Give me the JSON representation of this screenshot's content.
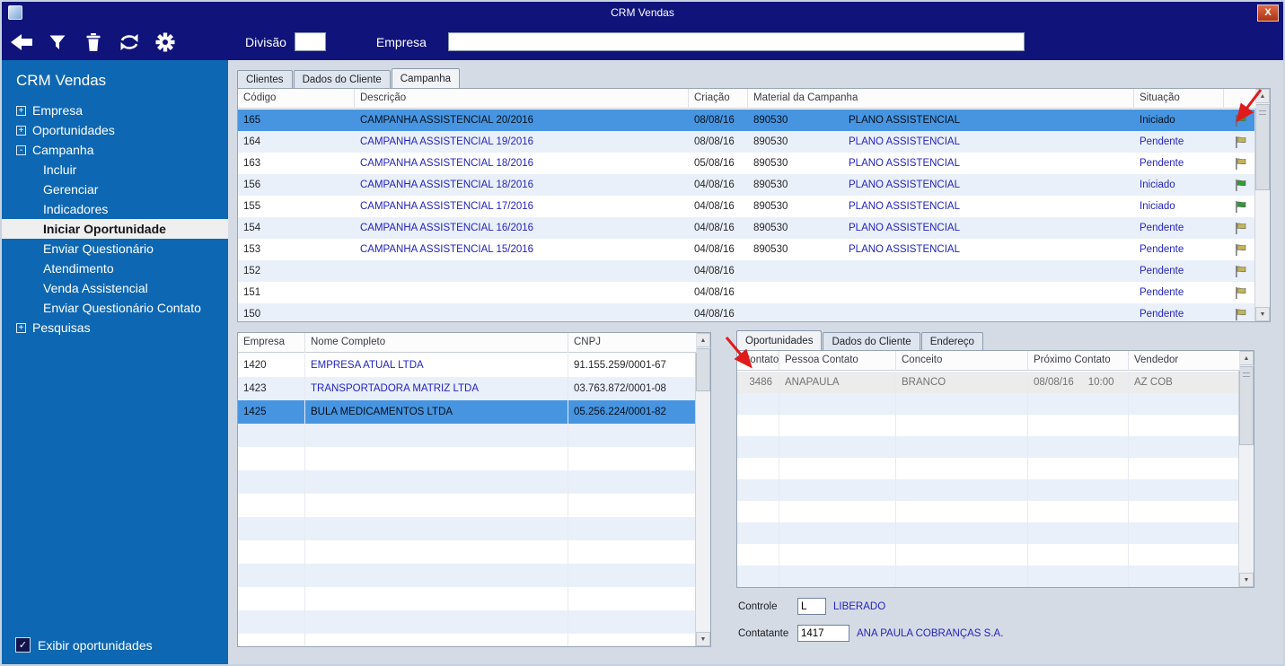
{
  "colors": {
    "accent_navy": "#10137a",
    "sidebar_blue": "#0e67b2",
    "selection_blue": "#4795e0",
    "data_blue": "#2424bc",
    "flag_green": "#2f9b38",
    "flag_yellow": "#c4b35a",
    "annotation_red": "#e01b1b"
  },
  "window": {
    "title": "CRM Vendas",
    "close_glyph": "X"
  },
  "toolbar": {
    "icons": [
      "back-icon",
      "filter-icon",
      "delete-icon",
      "refresh-icon",
      "settings-icon"
    ],
    "divisao_label": "Divisão",
    "divisao_value": "",
    "empresa_label": "Empresa",
    "empresa_value": ""
  },
  "sidebar": {
    "title": "CRM Vendas",
    "items": [
      {
        "label": "Empresa",
        "expand": "+",
        "level": 0
      },
      {
        "label": "Oportunidades",
        "expand": "+",
        "level": 0
      },
      {
        "label": "Campanha",
        "expand": "-",
        "level": 0
      },
      {
        "label": "Incluir",
        "level": 1
      },
      {
        "label": "Gerenciar",
        "level": 1
      },
      {
        "label": "Indicadores",
        "level": 1
      },
      {
        "label": "Iniciar Oportunidade",
        "level": 1,
        "selected": true
      },
      {
        "label": "Enviar Questionário",
        "level": 1
      },
      {
        "label": "Atendimento",
        "level": 1
      },
      {
        "label": "Venda Assistencial",
        "level": 1
      },
      {
        "label": "Enviar Questionário Contato",
        "level": 1
      },
      {
        "label": "Pesquisas",
        "expand": "+",
        "level": 0
      }
    ],
    "exibir_checkbox": {
      "label": "Exibir oportunidades",
      "checked": true,
      "check_glyph": "✓"
    }
  },
  "main_tabs": {
    "tabs": [
      "Clientes",
      "Dados do Cliente",
      "Campanha"
    ],
    "active": "Campanha"
  },
  "campaign_table": {
    "columns": {
      "codigo": "Código",
      "descricao": "Descrição",
      "criacao": "Criação",
      "material": "Material da Campanha",
      "situacao": "Situação"
    },
    "rows": [
      {
        "codigo": "165",
        "descricao": "CAMPANHA ASSISTENCIAL 20/2016",
        "criacao": "08/08/16",
        "material_cod": "890530",
        "material": "PLANO ASSISTENCIAL",
        "situacao": "Iniciado",
        "flag": "green",
        "selected": true
      },
      {
        "codigo": "164",
        "descricao": "CAMPANHA ASSISTENCIAL 19/2016",
        "criacao": "08/08/16",
        "material_cod": "890530",
        "material": "PLANO ASSISTENCIAL",
        "situacao": "Pendente",
        "flag": "yellow"
      },
      {
        "codigo": "163",
        "descricao": "CAMPANHA ASSISTENCIAL 18/2016",
        "criacao": "05/08/16",
        "material_cod": "890530",
        "material": "PLANO ASSISTENCIAL",
        "situacao": "Pendente",
        "flag": "yellow"
      },
      {
        "codigo": "156",
        "descricao": "CAMPANHA ASSISTENCIAL 18/2016",
        "criacao": "04/08/16",
        "material_cod": "890530",
        "material": "PLANO ASSISTENCIAL",
        "situacao": "Iniciado",
        "flag": "green"
      },
      {
        "codigo": "155",
        "descricao": "CAMPANHA ASSISTENCIAL 17/2016",
        "criacao": "04/08/16",
        "material_cod": "890530",
        "material": "PLANO ASSISTENCIAL",
        "situacao": "Iniciado",
        "flag": "green"
      },
      {
        "codigo": "154",
        "descricao": "CAMPANHA ASSISTENCIAL 16/2016",
        "criacao": "04/08/16",
        "material_cod": "890530",
        "material": "PLANO ASSISTENCIAL",
        "situacao": "Pendente",
        "flag": "yellow"
      },
      {
        "codigo": "153",
        "descricao": "CAMPANHA ASSISTENCIAL 15/2016",
        "criacao": "04/08/16",
        "material_cod": "890530",
        "material": "PLANO ASSISTENCIAL",
        "situacao": "Pendente",
        "flag": "yellow"
      },
      {
        "codigo": "152",
        "descricao": "",
        "criacao": "04/08/16",
        "material_cod": "",
        "material": "",
        "situacao": "Pendente",
        "flag": "yellow"
      },
      {
        "codigo": "151",
        "descricao": "",
        "criacao": "04/08/16",
        "material_cod": "",
        "material": "",
        "situacao": "Pendente",
        "flag": "yellow"
      },
      {
        "codigo": "150",
        "descricao": "",
        "criacao": "04/08/16",
        "material_cod": "",
        "material": "",
        "situacao": "Pendente",
        "flag": "yellow"
      }
    ]
  },
  "company_table": {
    "columns": {
      "empresa": "Empresa",
      "nome": "Nome Completo",
      "cnpj": "CNPJ"
    },
    "rows": [
      {
        "empresa": "1420",
        "nome": "EMPRESA ATUAL LTDA",
        "cnpj": "91.155.259/0001-67"
      },
      {
        "empresa": "1423",
        "nome": "TRANSPORTADORA MATRIZ LTDA",
        "cnpj": "03.763.872/0001-08"
      },
      {
        "empresa": "1425",
        "nome": "BULA MEDICAMENTOS LTDA",
        "cnpj": "05.256.224/0001-82",
        "selected": true
      }
    ]
  },
  "detail_panel": {
    "tabs": [
      "Oportunidades",
      "Dados do Cliente",
      "Endereço"
    ],
    "active": "Oportunidades",
    "contacts_table": {
      "columns": {
        "contato": "Contato",
        "pessoa": "Pessoa Contato",
        "conceito": "Conceito",
        "proximo": "Próximo Contato",
        "vendedor": "Vendedor"
      },
      "rows": [
        {
          "contato": "3486",
          "pessoa": "ANAPAULA",
          "conceito": "BRANCO",
          "proximo_data": "08/08/16",
          "proximo_hora": "10:00",
          "vendedor": "AZ COB",
          "muted": true
        }
      ]
    },
    "controle": {
      "label": "Controle",
      "value": "L",
      "text": "LIBERADO"
    },
    "contatante": {
      "label": "Contatante",
      "value": "1417",
      "text": "ANA PAULA COBRANÇAS S.A."
    }
  },
  "scrollbar": {
    "up": "▲",
    "down": "▼"
  },
  "annotations": [
    "arrow-to-campaign-flag",
    "arrow-to-contato-column"
  ]
}
